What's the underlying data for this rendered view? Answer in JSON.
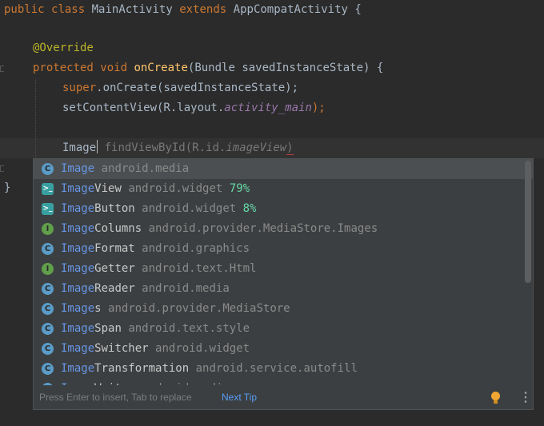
{
  "code": {
    "line1": {
      "kw_public": "public",
      "kw_class": "class",
      "class_name": "MainActivity",
      "kw_extends": "extends",
      "super_class": "AppCompatActivity",
      "brace": "{"
    },
    "line3": {
      "annotation": "@Override"
    },
    "line4": {
      "kw_protected": "protected",
      "kw_void": "void",
      "method": "onCreate",
      "params": "(Bundle savedInstanceState) {"
    },
    "line5": {
      "kw_super": "super",
      "call": ".onCreate(savedInstanceState);"
    },
    "line6": {
      "call": "setContentView(R.layout.",
      "field": "activity_main",
      "end": ");"
    },
    "line8": {
      "typed": "Image",
      "ghost_call": "findViewById(R.id.",
      "ghost_field": "imageView",
      "ghost_end": ")"
    },
    "line10": {
      "brace": "}"
    }
  },
  "completion": {
    "items": [
      {
        "icon": "class-icon",
        "icon_text": "C",
        "match": "Image",
        "rest": "",
        "pkg": "android.media",
        "pct": ""
      },
      {
        "icon": "android-view-icon",
        "icon_text": ">_",
        "match": "Image",
        "rest": "View",
        "pkg": "android.widget",
        "pct": "79%"
      },
      {
        "icon": "android-view-icon",
        "icon_text": ">_",
        "match": "Image",
        "rest": "Button",
        "pkg": "android.widget",
        "pct": "8%"
      },
      {
        "icon": "interface-icon",
        "icon_text": "I",
        "match": "Image",
        "rest": "Columns",
        "pkg": "android.provider.MediaStore.Images",
        "pct": ""
      },
      {
        "icon": "class-icon",
        "icon_text": "C",
        "match": "Image",
        "rest": "Format",
        "pkg": "android.graphics",
        "pct": ""
      },
      {
        "icon": "interface-icon",
        "icon_text": "I",
        "match": "Image",
        "rest": "Getter",
        "pkg": "android.text.Html",
        "pct": ""
      },
      {
        "icon": "class-icon",
        "icon_text": "C",
        "match": "Image",
        "rest": "Reader",
        "pkg": "android.media",
        "pct": ""
      },
      {
        "icon": "class-icon",
        "icon_text": "C",
        "match": "Image",
        "rest": "s",
        "pkg": "android.provider.MediaStore",
        "pct": ""
      },
      {
        "icon": "class-icon",
        "icon_text": "C",
        "match": "Image",
        "rest": "Span",
        "pkg": "android.text.style",
        "pct": ""
      },
      {
        "icon": "class-icon",
        "icon_text": "C",
        "match": "Image",
        "rest": "Switcher",
        "pkg": "android.widget",
        "pct": ""
      },
      {
        "icon": "class-icon",
        "icon_text": "C",
        "match": "Image",
        "rest": "Transformation",
        "pkg": "android.service.autofill",
        "pct": ""
      },
      {
        "icon": "class-icon",
        "icon_text": "C",
        "match": "Image",
        "rest": "Writer",
        "pkg": "android.media",
        "pct": ""
      }
    ],
    "hint": "Press Enter to insert, Tab to replace",
    "next_tip": "Next Tip"
  },
  "colors": {
    "editor_bg": "#2b2b2b",
    "keyword": "#cc7832",
    "popup_bg": "#3c3f41",
    "match": "#6796e6"
  }
}
